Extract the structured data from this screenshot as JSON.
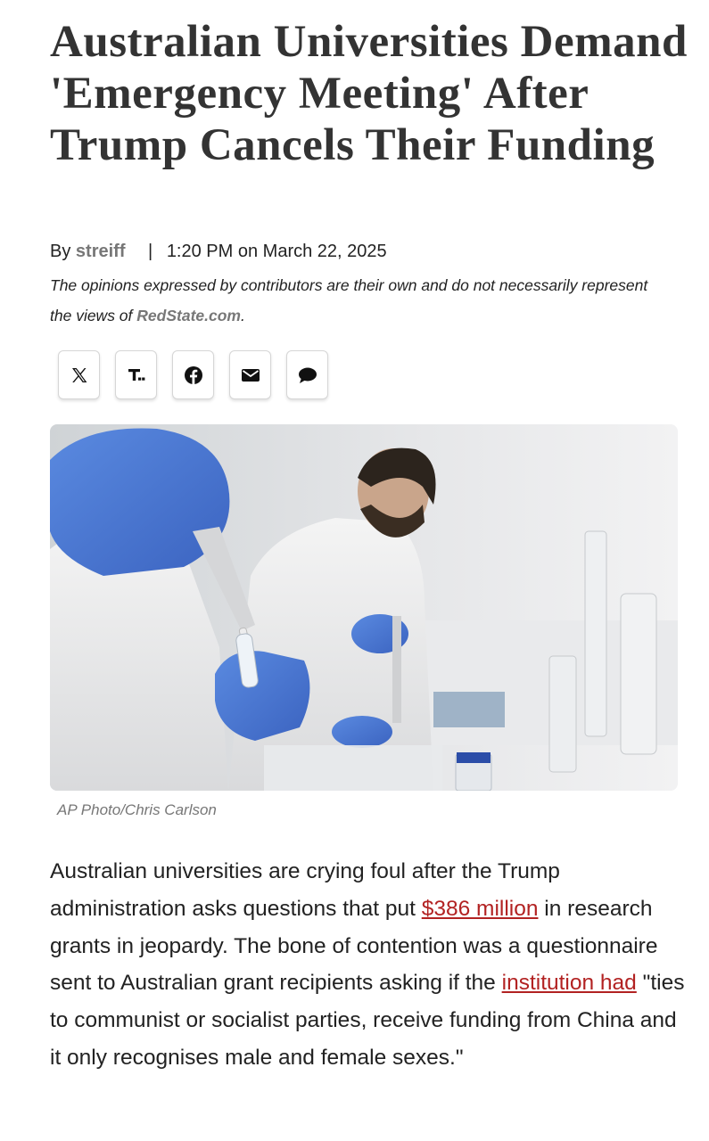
{
  "article": {
    "headline": "Australian Universities Demand 'Emergency Meeting' After Trump Cancels Their Funding",
    "byline": {
      "prefix": "By",
      "author": "streiff",
      "separator": "|",
      "timestamp": "1:20 PM on March 22, 2025"
    },
    "disclaimer": {
      "text": "The opinions expressed by contributors are their own and do not necessarily represent the views of",
      "site": "RedState.com",
      "end": "."
    },
    "share_buttons": [
      {
        "name": "x-share",
        "icon": "x-logo-icon"
      },
      {
        "name": "townhall-share",
        "icon": "townhall-t-icon"
      },
      {
        "name": "facebook-share",
        "icon": "facebook-icon"
      },
      {
        "name": "email-share",
        "icon": "envelope-icon"
      },
      {
        "name": "comments",
        "icon": "speech-bubble-icon"
      }
    ],
    "image_caption": "AP Photo/Chris Carlson",
    "body": {
      "part1": "Australian universities are crying foul after the Trump administration asks questions that put",
      "link1": "$386 million",
      "part2": "in research grants in jeopardy. The bone of contention was a questionnaire sent to Australian grant recipients asking if the",
      "link2": "institution had",
      "part3": "\"ties to communist or socialist parties, receive funding from China and it only recognises male and female sexes.\""
    }
  },
  "colors": {
    "headline": "#333333",
    "muted": "#777777",
    "link": "#b22222",
    "glove": "#4a78d6"
  }
}
